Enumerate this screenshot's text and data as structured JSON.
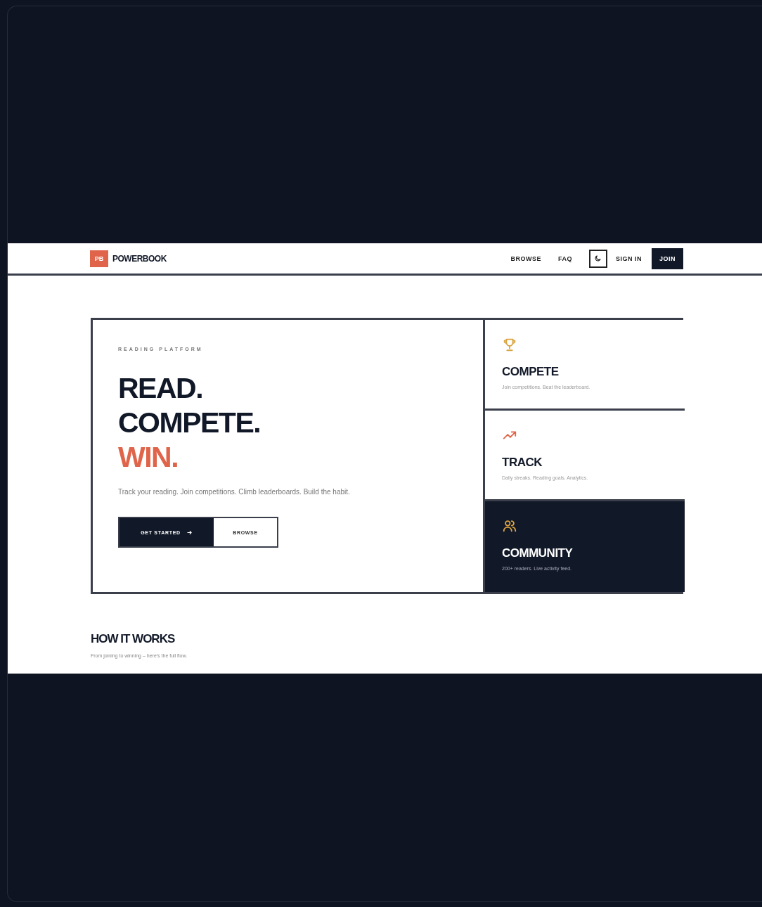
{
  "nav": {
    "logo_mark": "PB",
    "brand": "POWERBOOK",
    "links": [
      "BROWSE",
      "FAQ"
    ],
    "sign_in": "SIGN IN",
    "join": "JOIN"
  },
  "hero": {
    "eyebrow": "READING PLATFORM",
    "lines": [
      {
        "text": "READ.",
        "accent": false
      },
      {
        "text": "COMPETE.",
        "accent": false
      },
      {
        "text": "WIN.",
        "accent": true
      }
    ],
    "description": "Track your reading. Join competitions. Climb leaderboards. Build the habit.",
    "primary_button": "GET STARTED",
    "secondary_button": "BROWSE"
  },
  "features": [
    {
      "kind": "trophy",
      "title": "COMPETE",
      "text": "Join competitions. Beat the leaderboard.",
      "dark": false,
      "color": "#d9a441"
    },
    {
      "kind": "trend",
      "title": "TRACK",
      "text": "Daily streaks. Reading goals. Analytics.",
      "dark": false,
      "color": "#e0644a"
    },
    {
      "kind": "users",
      "title": "COMMUNITY",
      "text": "200+ readers. Live activity feed.",
      "dark": true,
      "color": "#d9a441"
    }
  ],
  "how_it_works": {
    "title": "HOW IT WORKS",
    "subtitle": "From joining to winning – here's the full flow."
  }
}
